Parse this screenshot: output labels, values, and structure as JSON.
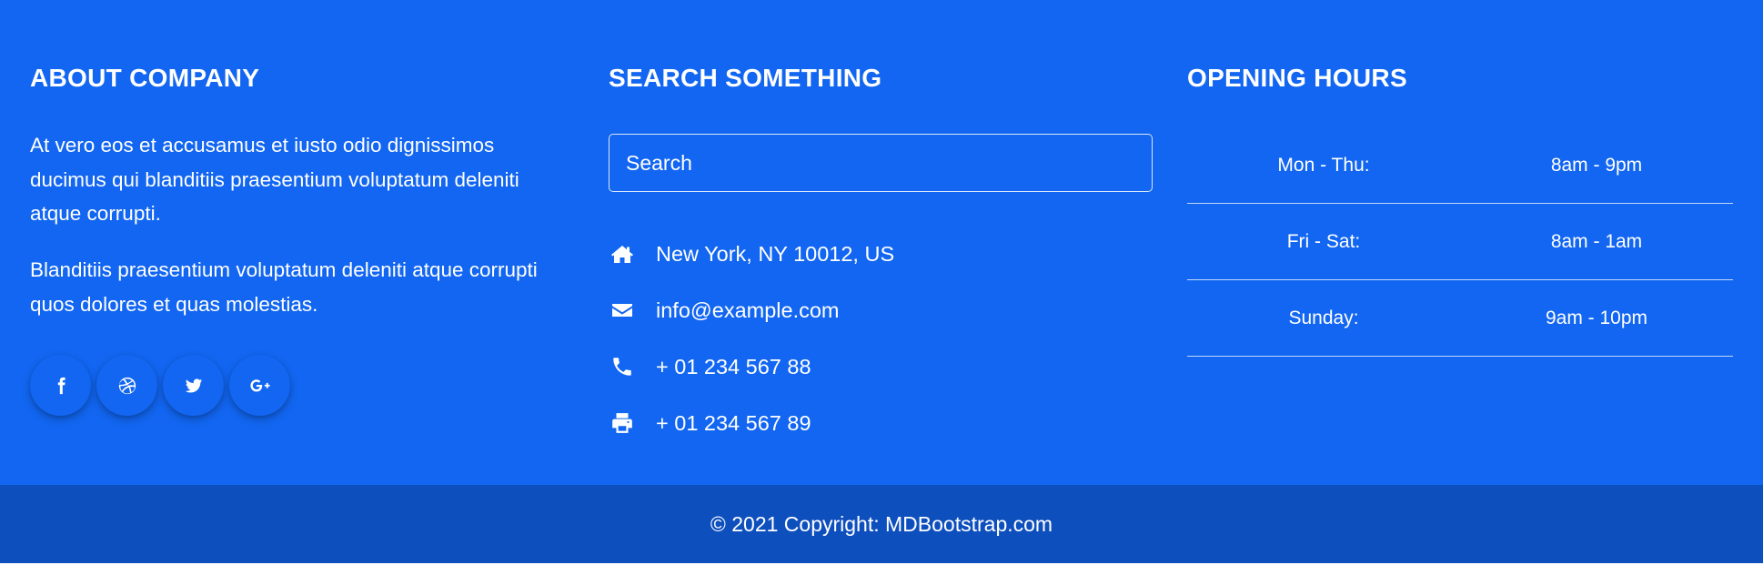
{
  "about": {
    "heading": "ABOUT COMPANY",
    "paragraph1": "At vero eos et accusamus et iusto odio dignissimos ducimus qui blanditiis praesentium voluptatum deleniti atque corrupti.",
    "paragraph2": "Blanditiis praesentium voluptatum deleniti atque corrupti quos dolores et quas molestias.",
    "social": [
      {
        "icon": "facebook-icon"
      },
      {
        "icon": "dribbble-icon"
      },
      {
        "icon": "twitter-icon"
      },
      {
        "icon": "google-plus-icon"
      }
    ]
  },
  "search": {
    "heading": "SEARCH SOMETHING",
    "placeholder": "Search",
    "contacts": [
      {
        "icon": "home-icon",
        "text": "New York, NY 10012, US"
      },
      {
        "icon": "envelope-icon",
        "text": "info@example.com"
      },
      {
        "icon": "phone-icon",
        "text": "+ 01 234 567 88"
      },
      {
        "icon": "printer-icon",
        "text": "+ 01 234 567 89"
      }
    ]
  },
  "hours": {
    "heading": "OPENING HOURS",
    "rows": [
      {
        "day": "Mon - Thu:",
        "time": "8am - 9pm"
      },
      {
        "day": "Fri - Sat:",
        "time": "8am - 1am"
      },
      {
        "day": "Sunday:",
        "time": "9am - 10pm"
      }
    ]
  },
  "copyright": "© 2021 Copyright: MDBootstrap.com",
  "colors": {
    "primary": "#1266f1",
    "bottom_bar": "#0e4fbe",
    "text": "#ffffff"
  }
}
